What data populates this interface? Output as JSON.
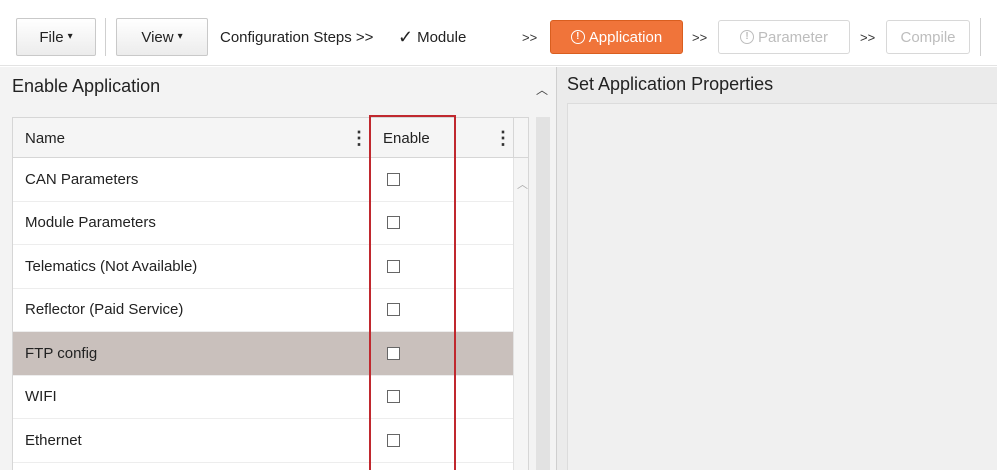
{
  "toolbar": {
    "file_label": "File",
    "view_label": "View",
    "config_steps_label": "Configuration Steps >>",
    "module_step": "Module",
    "arrows": ">>",
    "application_step": "Application",
    "parameter_step": "Parameter",
    "compile_step": "Compile",
    "check_glyph": "✓",
    "alert_glyph": "!",
    "caret_glyph": "▾",
    "active_color": "#f0743a"
  },
  "left_panel": {
    "title": "Enable Application",
    "columns": {
      "name": "Name",
      "enable": "Enable"
    },
    "rows": [
      {
        "name": "CAN Parameters",
        "enabled": false,
        "selected": false
      },
      {
        "name": "Module Parameters",
        "enabled": false,
        "selected": false
      },
      {
        "name": "Telematics (Not Available)",
        "enabled": false,
        "selected": false
      },
      {
        "name": "Reflector (Paid Service)",
        "enabled": false,
        "selected": false
      },
      {
        "name": "FTP config",
        "enabled": false,
        "selected": true
      },
      {
        "name": "WIFI",
        "enabled": false,
        "selected": false
      },
      {
        "name": "Ethernet",
        "enabled": false,
        "selected": false
      }
    ],
    "highlight_color": "#c0282e"
  },
  "right_panel": {
    "title": "Set Application Properties"
  }
}
